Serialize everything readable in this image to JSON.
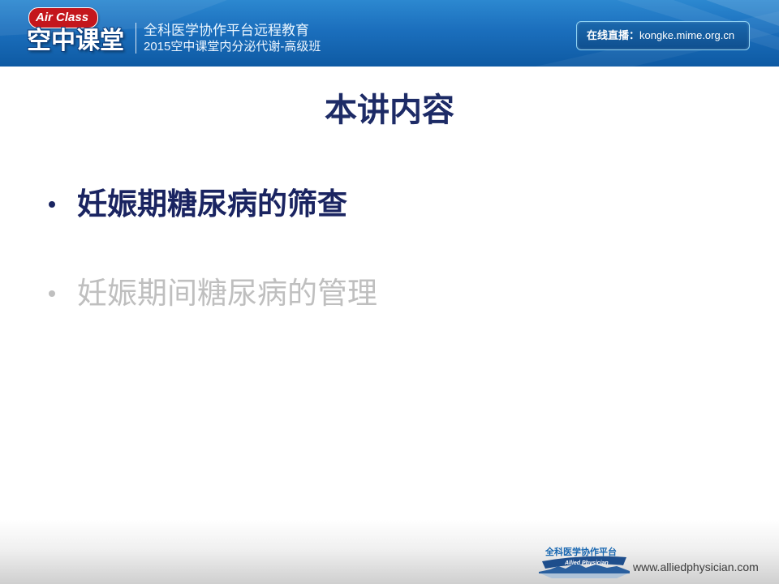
{
  "header": {
    "logo_badge": "Air Class",
    "logo_title": "空中课堂",
    "line1": "全科医学协作平台远程教育",
    "line2": "2015空中课堂内分泌代谢-高级班",
    "live_label": "在线直播：",
    "live_url": "kongke.mime.org.cn"
  },
  "slide": {
    "title": "本讲内容",
    "bullets": [
      {
        "text": "妊娠期糖尿病的筛查",
        "active": true
      },
      {
        "text": "妊娠期间糖尿病的管理",
        "active": false
      }
    ]
  },
  "footer": {
    "logo_cn": "全科医学协作平台",
    "logo_en": "Allied Physician",
    "url": "www.alliedphysician.com"
  },
  "colors": {
    "banner_blue": "#1b6fbd",
    "logo_badge_red": "#c4161c",
    "title": "#1d2b66",
    "bullet_active": "#1a2461",
    "bullet_inactive": "#bfbfbf"
  }
}
